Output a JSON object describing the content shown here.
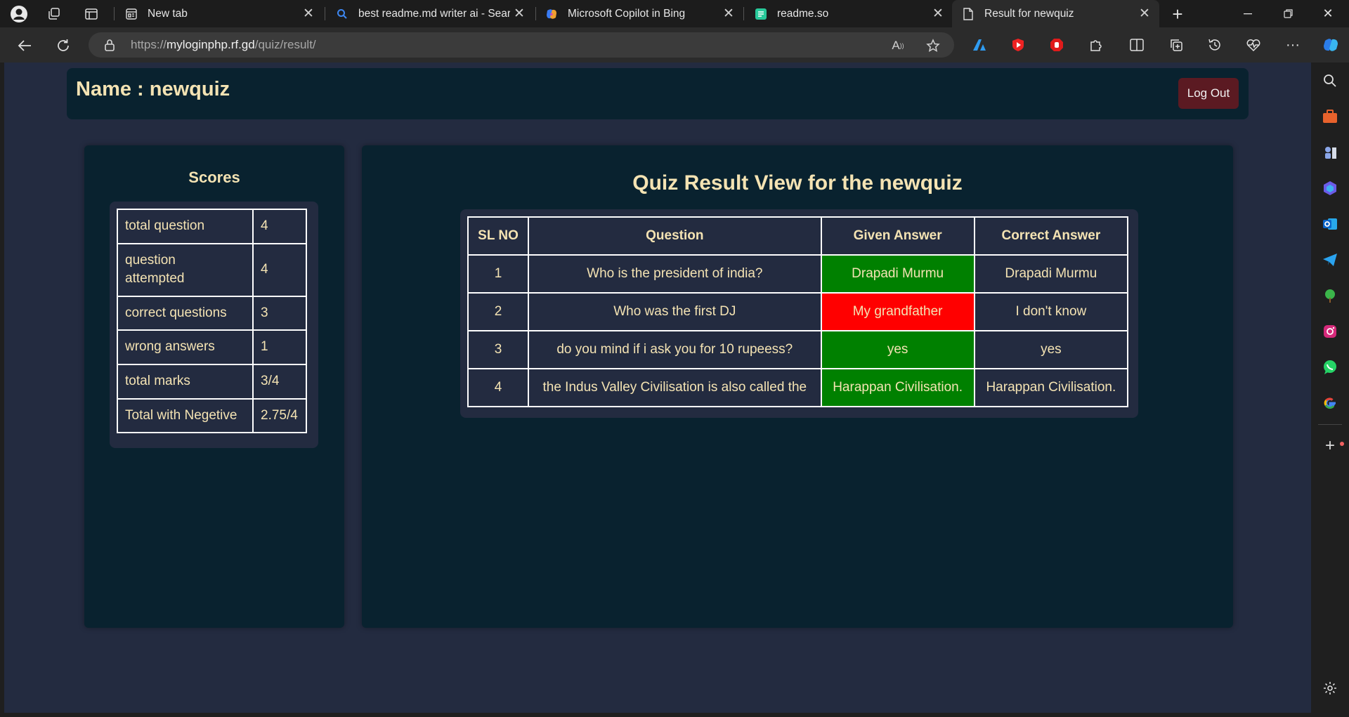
{
  "browser": {
    "tabs": [
      {
        "title": "New tab",
        "icon": "new-tab-page-icon",
        "active": false
      },
      {
        "title": "best readme.md writer ai - Search",
        "icon": "search-icon",
        "active": false
      },
      {
        "title": "Microsoft Copilot in Bing",
        "icon": "copilot-icon",
        "active": false
      },
      {
        "title": "readme.so",
        "icon": "readme-so-icon",
        "active": false
      },
      {
        "title": "Result for newquiz",
        "icon": "page-icon",
        "active": true
      }
    ],
    "url_prefix": "https://",
    "url_host": "myloginphp.rf.gd",
    "url_path": "/quiz/result/"
  },
  "header": {
    "name_label": "Name : newquiz",
    "logout_label": "Log Out"
  },
  "scores": {
    "title": "Scores",
    "rows": [
      {
        "label": "total question",
        "value": "4"
      },
      {
        "label": "question attempted",
        "value": "4"
      },
      {
        "label": "correct questions",
        "value": "3"
      },
      {
        "label": "wrong answers",
        "value": "1"
      },
      {
        "label": "total marks",
        "value": "3/4"
      },
      {
        "label": "Total with Negetive",
        "value": "2.75/4"
      }
    ]
  },
  "result": {
    "title": "Quiz Result View for the newquiz",
    "headers": [
      "SL NO",
      "Question",
      "Given Answer",
      "Correct Answer"
    ],
    "rows": [
      {
        "sl": "1",
        "question": "Who is the president of india?",
        "given": "Drapadi Murmu",
        "correct": "Drapadi Murmu",
        "is_correct": true
      },
      {
        "sl": "2",
        "question": "Who was the first DJ",
        "given": "My grandfather",
        "correct": "I don't know",
        "is_correct": false
      },
      {
        "sl": "3",
        "question": "do you mind if i ask you for 10 rupeess?",
        "given": "yes",
        "correct": "yes",
        "is_correct": true
      },
      {
        "sl": "4",
        "question": "the Indus Valley Civilisation is also called the",
        "given": "Harappan Civilisation.",
        "correct": "Harappan Civilisation.",
        "is_correct": true
      }
    ]
  },
  "colors": {
    "page_bg": "#232b40",
    "panel_bg": "#09222f",
    "text_accent": "#f4e3b3",
    "correct_cell": "#008000",
    "wrong_cell": "#ff0000",
    "logout_bg": "#5b1a22"
  }
}
